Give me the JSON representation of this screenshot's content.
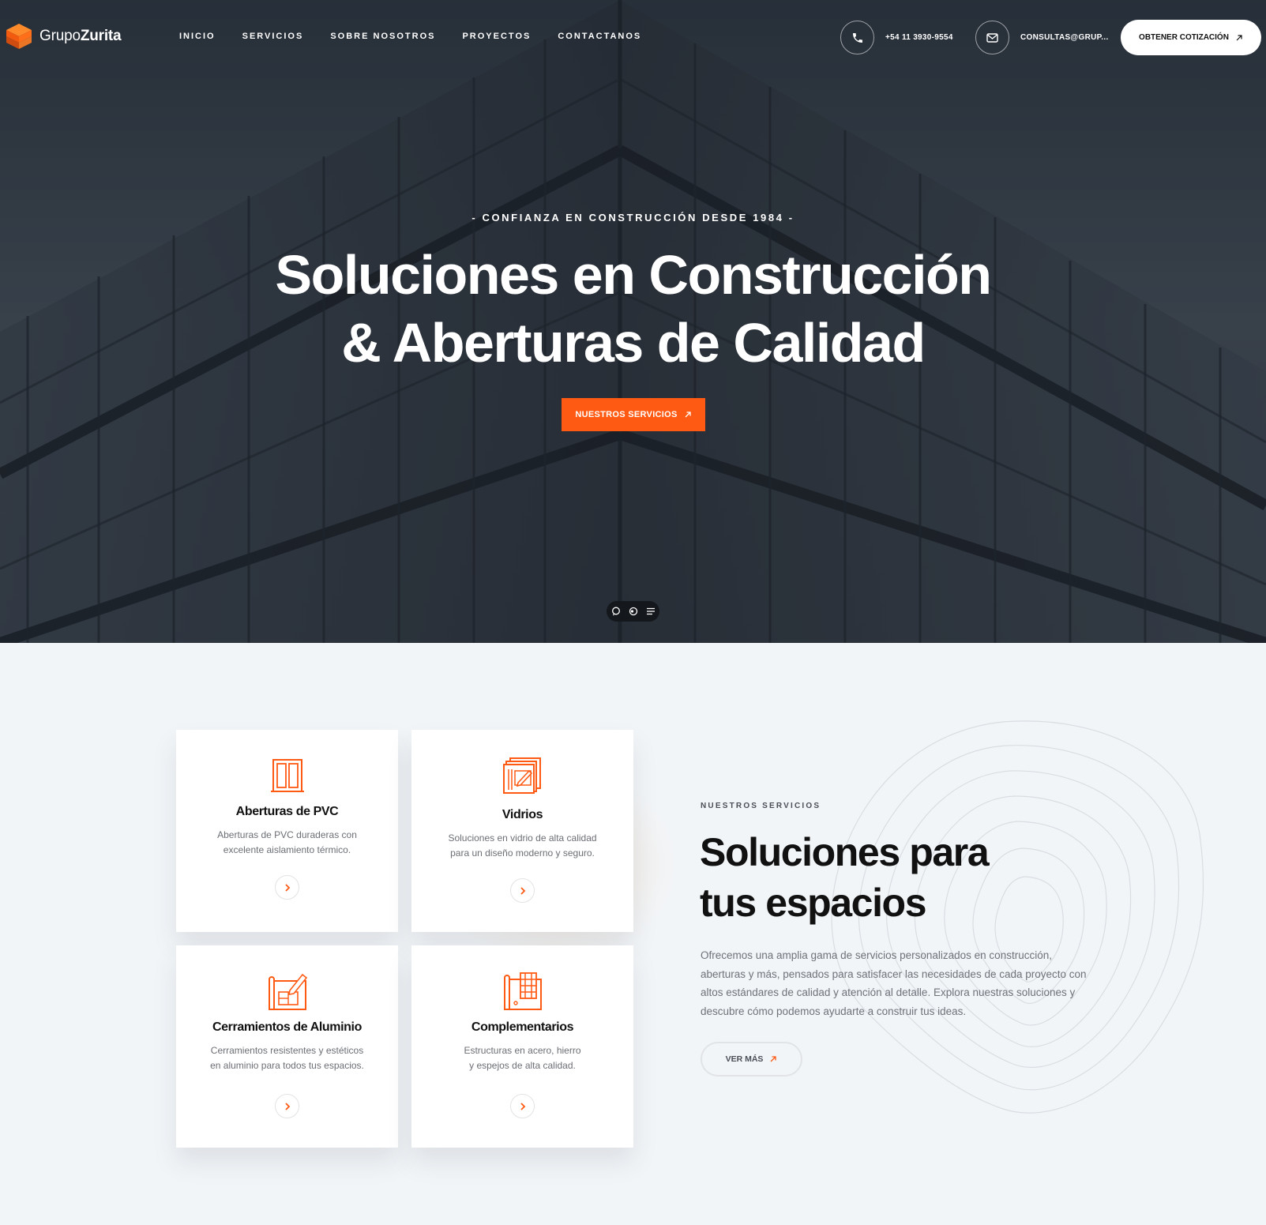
{
  "brand": {
    "name_light": "Grupo",
    "name_bold": "Zurita"
  },
  "nav": {
    "items": [
      {
        "label": "INICIO"
      },
      {
        "label": "SERVICIOS"
      },
      {
        "label": "SOBRE NOSOTROS"
      },
      {
        "label": "PROYECTOS"
      },
      {
        "label": "CONTACTANOS"
      }
    ]
  },
  "contact": {
    "phone": "+54 11 3930-9554",
    "email": "CONSULTAS@GRUP..."
  },
  "header": {
    "quote_button": "OBTENER COTIZACIÓN"
  },
  "hero": {
    "eyebrow": "- CONFIANZA EN CONSTRUCCIÓN DESDE 1984 -",
    "title_line1": "Soluciones en Construcción",
    "title_line2": "& Aberturas de Calidad",
    "cta": "NUESTROS SERVICIOS"
  },
  "services": {
    "eyebrow": "NUESTROS SERVICIOS",
    "title_line1": "Soluciones para",
    "title_line2": "tus espacios",
    "description": "Ofrecemos una amplia gama de servicios personalizados en construcción, aberturas y más, pensados para satisfacer las necesidades de cada proyecto con altos estándares de calidad y atención al detalle. Explora nuestras soluciones y descubre cómo podemos ayudarte a construir tus ideas.",
    "more_button": "VER MÁS",
    "cards": [
      {
        "title": "Aberturas de PVC",
        "desc_line1": "Aberturas de PVC duraderas con",
        "desc_line2": "excelente aislamiento térmico.",
        "icon": "window-icon"
      },
      {
        "title": "Vidrios",
        "desc_line1": "Soluciones en vidrio de alta calidad",
        "desc_line2": "para un diseño moderno y seguro.",
        "icon": "blueprint-pencil-icon"
      },
      {
        "title": "Cerramientos de Aluminio",
        "desc_line1": "Cerramientos resistentes y estéticos",
        "desc_line2": "en aluminio para todos tus espacios.",
        "icon": "plan-drawing-icon"
      },
      {
        "title": "Complementarios",
        "desc_line1": "Estructuras en acero, hierro",
        "desc_line2": "y espejos de alta calidad.",
        "icon": "steel-structure-icon"
      }
    ]
  },
  "colors": {
    "accent": "#ff5a13",
    "dark": "#111111",
    "muted": "#6e737a",
    "background": "#f2f5f8"
  }
}
